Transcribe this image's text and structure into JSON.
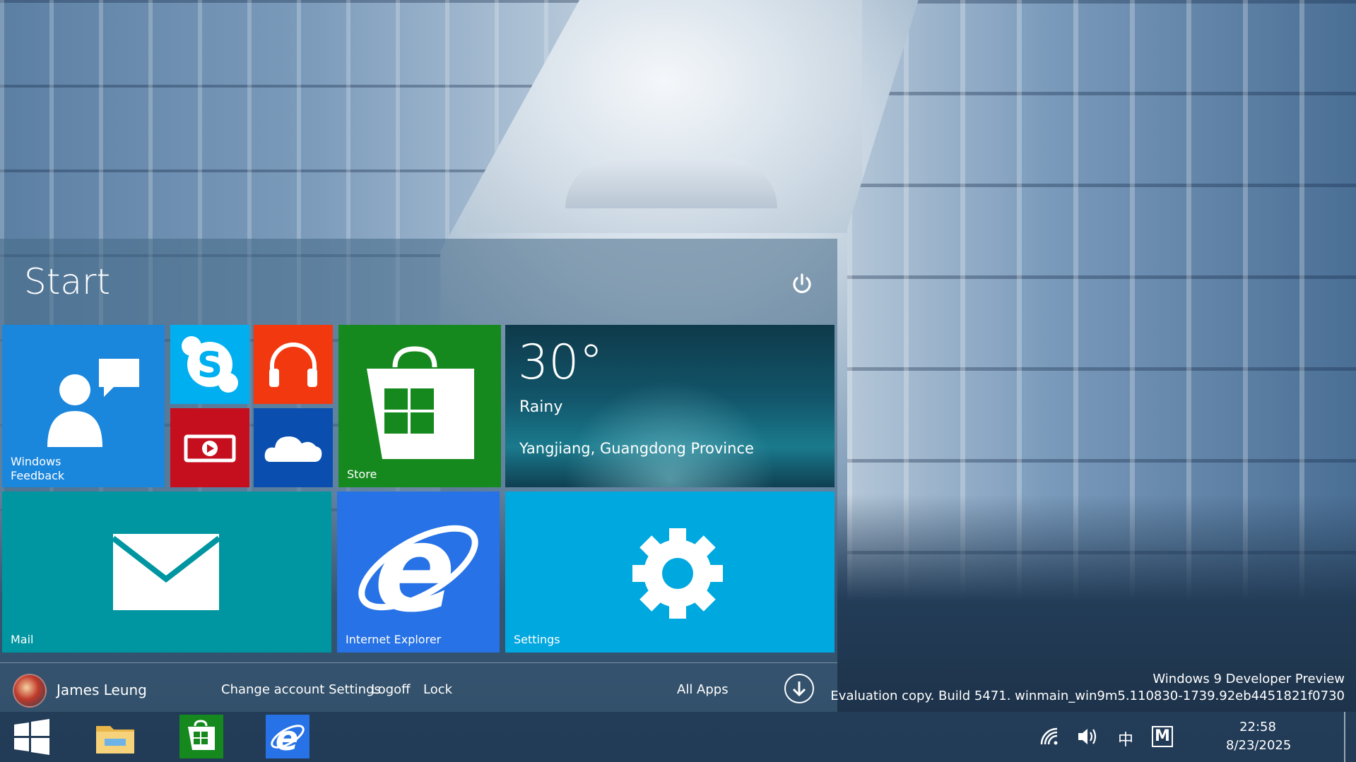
{
  "start": {
    "title": "Start",
    "power_icon": "power-icon"
  },
  "tiles": {
    "feedback": {
      "label_line1": "Windows",
      "label_line2": "Feedback",
      "color": "#1a86dc",
      "icon": "feedback-icon"
    },
    "skype": {
      "color": "#00aff0",
      "icon": "skype-icon"
    },
    "music": {
      "color": "#f2380f",
      "icon": "headphones-icon"
    },
    "video": {
      "color": "#c50f1f",
      "icon": "video-icon"
    },
    "onedrive": {
      "color": "#0a4fb0",
      "icon": "cloud-icon"
    },
    "store": {
      "label": "Store",
      "color": "#15891e",
      "icon": "store-bag-icon"
    },
    "weather": {
      "temperature": "30°",
      "condition": "Rainy",
      "location": "Yangjiang, Guangdong Province"
    },
    "mail": {
      "label": "Mail",
      "color": "#0096a1",
      "icon": "mail-envelope-icon"
    },
    "ie": {
      "label": "Internet Explorer",
      "color": "#2672e6",
      "icon": "ie-logo-icon"
    },
    "settings": {
      "label": "Settings",
      "color": "#00a8e0",
      "icon": "gear-icon"
    }
  },
  "account": {
    "user_name": "James Leung",
    "change_settings": "Change account Settings",
    "logoff": "Logoff",
    "lock": "Lock",
    "all_apps": "All Apps"
  },
  "watermark": {
    "line1": "Windows 9 Developer Preview",
    "line2": "Evaluation copy. Build 5471. winmain_win9m5.110830-1739.92eb4451821f0730"
  },
  "taskbar": {
    "items": [
      "start-logo-icon",
      "file-explorer-icon",
      "store-icon",
      "internet-explorer-icon"
    ],
    "ime_label": "中",
    "ime_mode": "M",
    "time": "22:58",
    "date": "8/23/2025"
  }
}
